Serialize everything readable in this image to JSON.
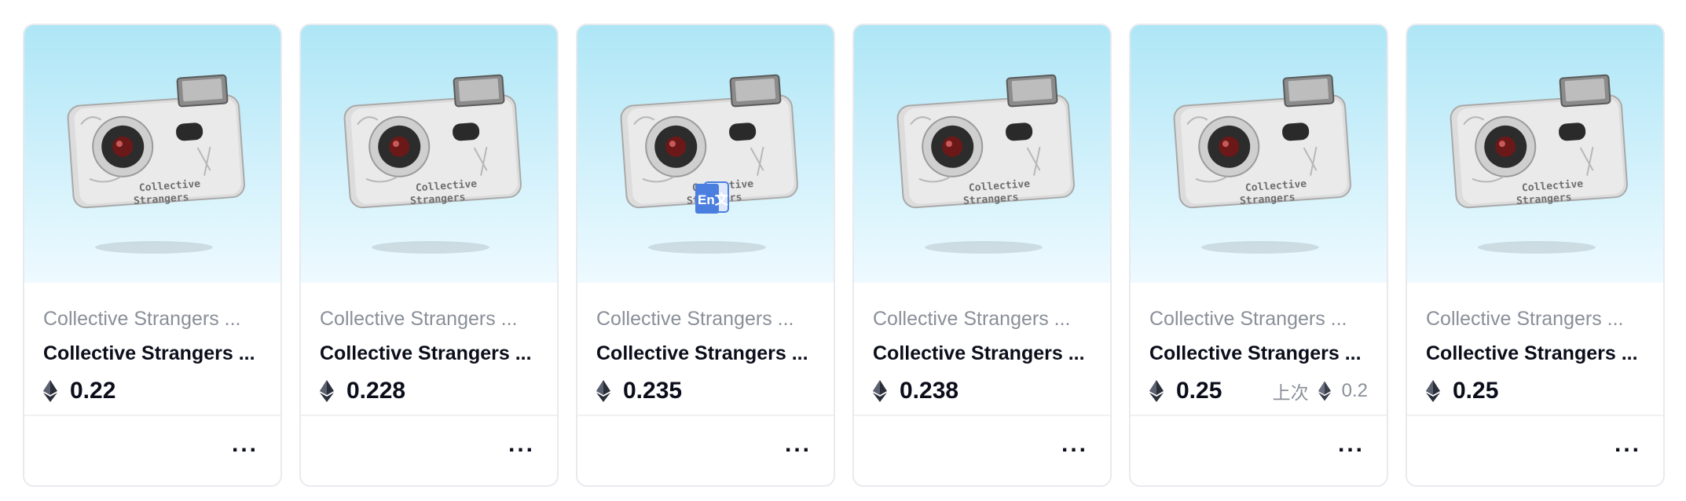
{
  "cards": [
    {
      "collection": "Collective Strangers ...",
      "name": "Collective Strangers ...",
      "price": "0.22",
      "last_label": "",
      "last_price": "",
      "more": "..."
    },
    {
      "collection": "Collective Strangers ...",
      "name": "Collective Strangers ...",
      "price": "0.228",
      "last_label": "",
      "last_price": "",
      "more": "..."
    },
    {
      "collection": "Collective Strangers ...",
      "name": "Collective Strangers ...",
      "price": "0.235",
      "last_label": "",
      "last_price": "",
      "more": "..."
    },
    {
      "collection": "Collective Strangers ...",
      "name": "Collective Strangers ...",
      "price": "0.238",
      "last_label": "",
      "last_price": "",
      "more": "..."
    },
    {
      "collection": "Collective Strangers ...",
      "name": "Collective Strangers ...",
      "price": "0.25",
      "last_label": "上次",
      "last_price": "0.2",
      "more": "..."
    },
    {
      "collection": "Collective Strangers ...",
      "name": "Collective Strangers ...",
      "price": "0.25",
      "last_label": "",
      "last_price": "",
      "more": "..."
    }
  ],
  "nft_image": {
    "icon": "camera-nft-image",
    "camera_text_line1": "Collective",
    "camera_text_line2": "Strangers"
  },
  "currency_icon": "ethereum-icon",
  "overlay": {
    "icon": "translate-icon",
    "text": "En文"
  },
  "colors": {
    "background_top": "#aee6f6",
    "background_bottom": "#eefaff",
    "text_primary": "#0b0e1a",
    "text_secondary": "#8a8f98",
    "translate_blue": "#4a7fe0"
  }
}
